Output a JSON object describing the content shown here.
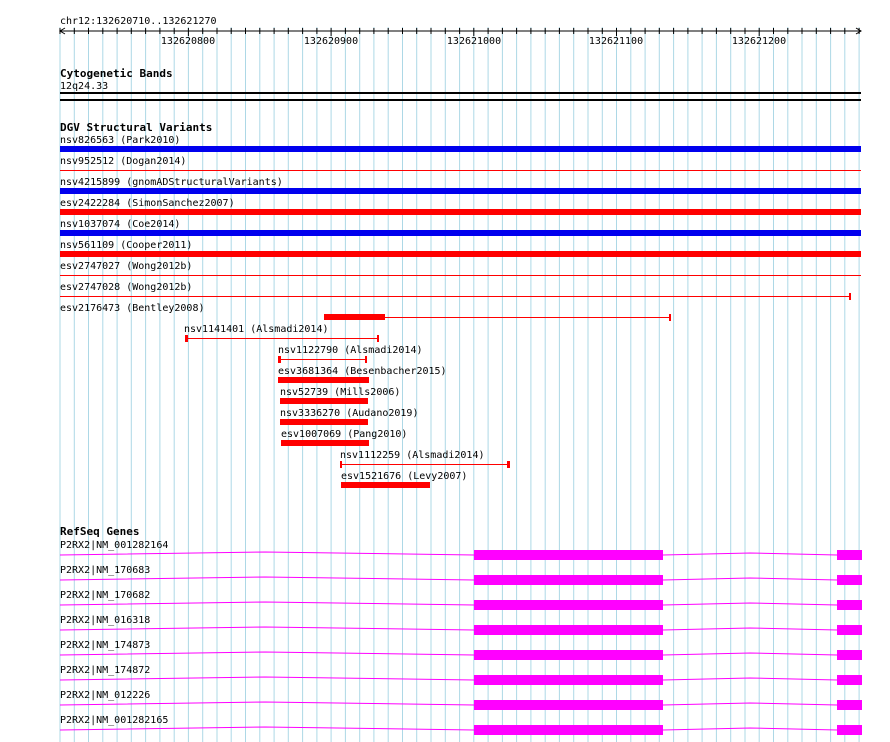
{
  "browser": {
    "region": "chr12:132620710..132621270",
    "ticks": [
      "132620800",
      "132620900",
      "132621000",
      "132621100",
      "132621200"
    ],
    "colors": {
      "grid": "#add8e6",
      "blue_variant": "#0000ee",
      "red_variant": "#ff0000",
      "gene": "#ff00ff"
    }
  },
  "cytoband": {
    "title": "Cytogenetic Bands",
    "band": "12q24.33"
  },
  "dgv": {
    "title": "DGV Structural Variants",
    "items": [
      {
        "label": "nsv826563 (Park2010)",
        "color": "blue"
      },
      {
        "label": "nsv952512 (Dogan2014)",
        "color": "red"
      },
      {
        "label": "nsv4215899 (gnomADStructuralVariants)",
        "color": "blue"
      },
      {
        "label": "esv2422284 (SimonSanchez2007)",
        "color": "red"
      },
      {
        "label": "nsv1037074 (Coe2014)",
        "color": "blue"
      },
      {
        "label": "nsv561109 (Cooper2011)",
        "color": "red"
      },
      {
        "label": "esv2747027 (Wong2012b)",
        "color": "red"
      },
      {
        "label": "esv2747028 (Wong2012b)",
        "color": "red"
      },
      {
        "label": "esv2176473 (Bentley2008)",
        "color": "red"
      },
      {
        "label": "nsv1141401 (Alsmadi2014)",
        "color": "red"
      },
      {
        "label": "nsv1122790 (Alsmadi2014)",
        "color": "red"
      },
      {
        "label": "esv3681364 (Besenbacher2015)",
        "color": "red"
      },
      {
        "label": "nsv52739 (Mills2006)",
        "color": "red"
      },
      {
        "label": "nsv3336270 (Audano2019)",
        "color": "red"
      },
      {
        "label": "esv1007069 (Pang2010)",
        "color": "red"
      },
      {
        "label": "nsv1112259 (Alsmadi2014)",
        "color": "red"
      },
      {
        "label": "esv1521676 (Levy2007)",
        "color": "red"
      }
    ]
  },
  "refseq": {
    "title": "RefSeq Genes",
    "transcripts": [
      "P2RX2|NM_001282164",
      "P2RX2|NM_170683",
      "P2RX2|NM_170682",
      "P2RX2|NM_016318",
      "P2RX2|NM_174873",
      "P2RX2|NM_174872",
      "P2RX2|NM_012226",
      "P2RX2|NM_001282165"
    ]
  }
}
